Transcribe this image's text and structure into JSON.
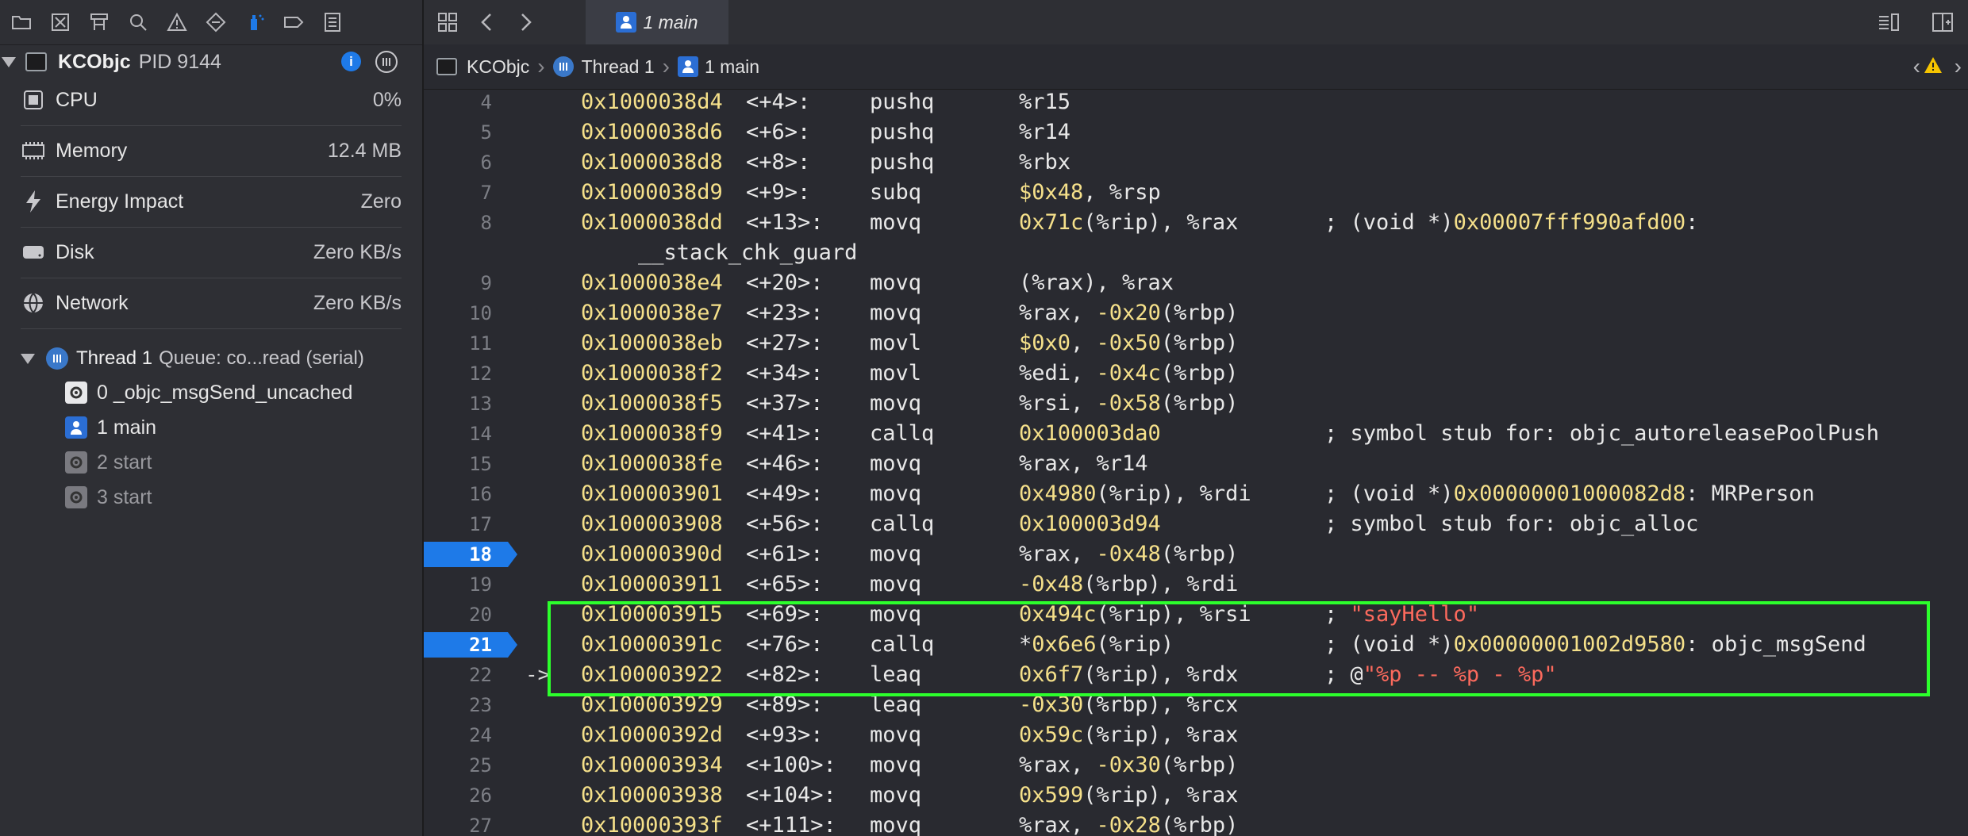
{
  "navigator": {
    "toolbar_icons": [
      "folder-icon",
      "source-control-icon",
      "hierarchy-icon",
      "search-icon",
      "warning-icon",
      "test-diamond-icon",
      "debug-spray-icon",
      "breakpoint-tag-icon",
      "report-icon"
    ],
    "process": {
      "name": "KCObjc",
      "pid": "PID 9144"
    },
    "gauges": [
      {
        "label": "CPU",
        "value": "0%"
      },
      {
        "label": "Memory",
        "value": "12.4 MB"
      },
      {
        "label": "Energy Impact",
        "value": "Zero"
      },
      {
        "label": "Disk",
        "value": "Zero KB/s"
      },
      {
        "label": "Network",
        "value": "Zero KB/s"
      }
    ],
    "thread": {
      "name": "Thread 1",
      "queue": "Queue: co...read (serial)"
    },
    "frames": [
      {
        "label": "0 _objc_msgSend_uncached"
      },
      {
        "label": "1 main"
      },
      {
        "label": "2 start"
      },
      {
        "label": "3 start"
      }
    ]
  },
  "editor": {
    "tab": {
      "label": "1 main"
    },
    "jumpbar": {
      "project": "KCObjc",
      "thread": "Thread 1",
      "frame": "1 main"
    },
    "lines": [
      {
        "n": "4",
        "addr": "0x1000038d4",
        "off": "<+4>:",
        "mn": "pushq",
        "op": "%r15"
      },
      {
        "n": "5",
        "addr": "0x1000038d6",
        "off": "<+6>:",
        "mn": "pushq",
        "op": "%r14"
      },
      {
        "n": "6",
        "addr": "0x1000038d8",
        "off": "<+8>:",
        "mn": "pushq",
        "op": "%rbx"
      },
      {
        "n": "7",
        "addr": "0x1000038d9",
        "off": "<+9>:",
        "mn": "subq",
        "op_num": "$0x48",
        "op_rest": ", %rsp"
      },
      {
        "n": "8",
        "addr": "0x1000038dd",
        "off": "<+13>:",
        "mn": "movq",
        "op_num": "0x71c",
        "op_rest": "(%rip), %rax",
        "c_pre": "; (void *)",
        "c_num": "0x00007fff990afd00",
        "c_post": ":"
      },
      {
        "n": "",
        "cont": "__stack_chk_guard"
      },
      {
        "n": "9",
        "addr": "0x1000038e4",
        "off": "<+20>:",
        "mn": "movq",
        "op": "(%rax), %rax"
      },
      {
        "n": "10",
        "addr": "0x1000038e7",
        "off": "<+23>:",
        "mn": "movq",
        "op": "%rax, ",
        "op_num2": "-0x20",
        "op_rest2": "(%rbp)"
      },
      {
        "n": "11",
        "addr": "0x1000038eb",
        "off": "<+27>:",
        "mn": "movl",
        "op_num": "$0x0",
        "op_rest": ", ",
        "op_num2": "-0x50",
        "op_rest2": "(%rbp)"
      },
      {
        "n": "12",
        "addr": "0x1000038f2",
        "off": "<+34>:",
        "mn": "movl",
        "op": "%edi, ",
        "op_num2": "-0x4c",
        "op_rest2": "(%rbp)"
      },
      {
        "n": "13",
        "addr": "0x1000038f5",
        "off": "<+37>:",
        "mn": "movq",
        "op": "%rsi, ",
        "op_num2": "-0x58",
        "op_rest2": "(%rbp)"
      },
      {
        "n": "14",
        "addr": "0x1000038f9",
        "off": "<+41>:",
        "mn": "callq",
        "op_num": "0x100003da0",
        "c_pre": "; symbol stub for: objc_autoreleasePoolPush"
      },
      {
        "n": "15",
        "addr": "0x1000038fe",
        "off": "<+46>:",
        "mn": "movq",
        "op": "%rax, %r14"
      },
      {
        "n": "16",
        "addr": "0x100003901",
        "off": "<+49>:",
        "mn": "movq",
        "op_num": "0x4980",
        "op_rest": "(%rip), %rdi",
        "c_pre": "; (void *)",
        "c_num": "0x00000001000082d8",
        "c_post": ": MRPerson"
      },
      {
        "n": "17",
        "addr": "0x100003908",
        "off": "<+56>:",
        "mn": "callq",
        "op_num": "0x100003d94",
        "c_pre": "; symbol stub for: objc_alloc"
      },
      {
        "n": "18",
        "bp": true,
        "addr": "0x10000390d",
        "off": "<+61>:",
        "mn": "movq",
        "op": "%rax, ",
        "op_num2": "-0x48",
        "op_rest2": "(%rbp)"
      },
      {
        "n": "19",
        "addr": "0x100003911",
        "off": "<+65>:",
        "mn": "movq",
        "op_num": "-0x48",
        "op_rest": "(%rbp), %rdi"
      },
      {
        "n": "20",
        "addr": "0x100003915",
        "off": "<+69>:",
        "mn": "movq",
        "op_num": "0x494c",
        "op_rest": "(%rip), %rsi",
        "c_pre": "; ",
        "c_str": "\"sayHello\""
      },
      {
        "n": "21",
        "bp": true,
        "addr": "0x10000391c",
        "off": "<+76>:",
        "mn": "callq",
        "op": "*",
        "op_num2": "0x6e6",
        "op_rest2": "(%rip)",
        "c_pre": "; (void *)",
        "c_num": "0x00000001002d9580",
        "c_post": ": objc_msgSend"
      },
      {
        "n": "22",
        "pc": "->",
        "addr": "0x100003922",
        "off": "<+82>:",
        "mn": "leaq",
        "op_num": "0x6f7",
        "op_rest": "(%rip), %rdx",
        "c_pre": "; @",
        "c_str": "\"%p -- %p - %p\""
      },
      {
        "n": "23",
        "addr": "0x100003929",
        "off": "<+89>:",
        "mn": "leaq",
        "op_num": "-0x30",
        "op_rest": "(%rbp), %rcx"
      },
      {
        "n": "24",
        "addr": "0x10000392d",
        "off": "<+93>:",
        "mn": "movq",
        "op_num": "0x59c",
        "op_rest": "(%rip), %rax"
      },
      {
        "n": "25",
        "addr": "0x100003934",
        "off": "<+100>:",
        "mn": "movq",
        "op": "%rax, ",
        "op_num2": "-0x30",
        "op_rest2": "(%rbp)"
      },
      {
        "n": "26",
        "addr": "0x100003938",
        "off": "<+104>:",
        "mn": "movq",
        "op_num": "0x599",
        "op_rest": "(%rip), %rax"
      },
      {
        "n": "27",
        "addr": "0x10000393f",
        "off": "<+111>:",
        "mn": "movq",
        "op": "%rax, ",
        "op_num2": "-0x28",
        "op_rest2": "(%rbp)"
      }
    ]
  },
  "colors": {
    "background": "#292a30",
    "address": "#f5e08a",
    "string": "#fc6a5d",
    "breakpoint": "#1e7ae8",
    "highlight_box": "#2cff2c"
  }
}
